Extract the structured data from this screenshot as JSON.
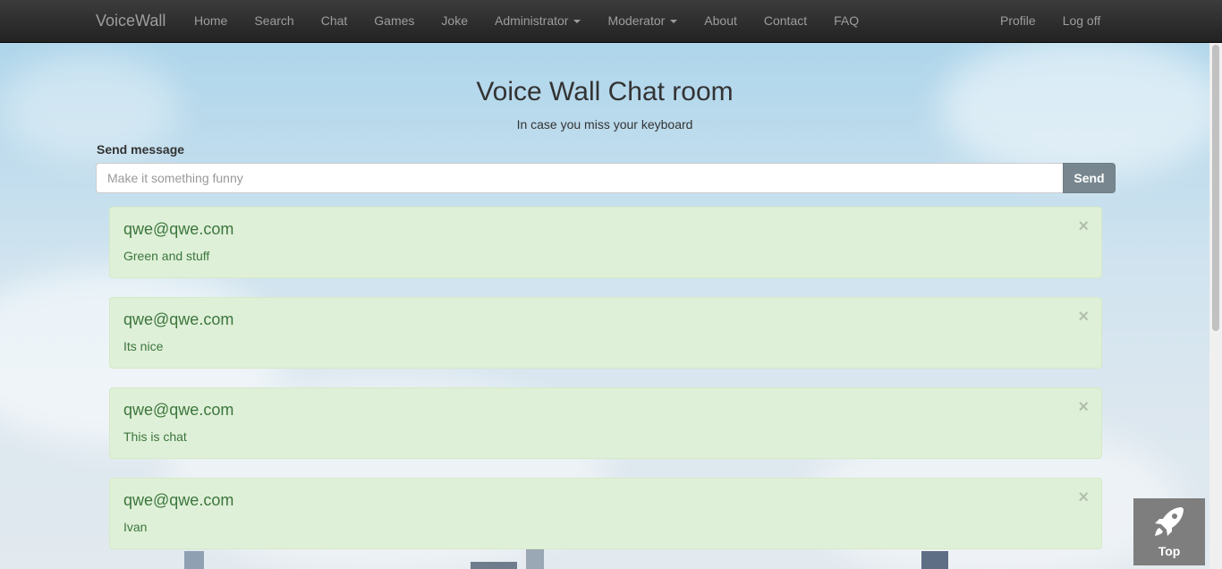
{
  "navbar": {
    "brand": "VoiceWall",
    "links": [
      {
        "label": "Home"
      },
      {
        "label": "Search"
      },
      {
        "label": "Chat"
      },
      {
        "label": "Games"
      },
      {
        "label": "Joke"
      },
      {
        "label": "Administrator",
        "dropdown": true
      },
      {
        "label": "Moderator",
        "dropdown": true
      },
      {
        "label": "About"
      },
      {
        "label": "Contact"
      },
      {
        "label": "FAQ"
      }
    ],
    "right_links": [
      {
        "label": "Profile"
      },
      {
        "label": "Log off"
      }
    ]
  },
  "header": {
    "title": "Voice Wall Chat room",
    "subtitle": "In case you miss your keyboard"
  },
  "composer": {
    "label": "Send message",
    "placeholder": "Make it something funny",
    "value": "",
    "send_label": "Send"
  },
  "messages": [
    {
      "author": "qwe@qwe.com",
      "text": "Green and stuff",
      "close": "×"
    },
    {
      "author": "qwe@qwe.com",
      "text": "Its nice",
      "close": "×"
    },
    {
      "author": "qwe@qwe.com",
      "text": "This is chat",
      "close": "×"
    },
    {
      "author": "qwe@qwe.com",
      "text": "Ivan",
      "close": "×"
    }
  ],
  "top_button": {
    "label": "Top",
    "icon": "rocket-icon"
  },
  "colors": {
    "navbar": "#222222",
    "message_bg": "#dff0d8",
    "message_text": "#3c763d",
    "send_button": "#78878f"
  }
}
